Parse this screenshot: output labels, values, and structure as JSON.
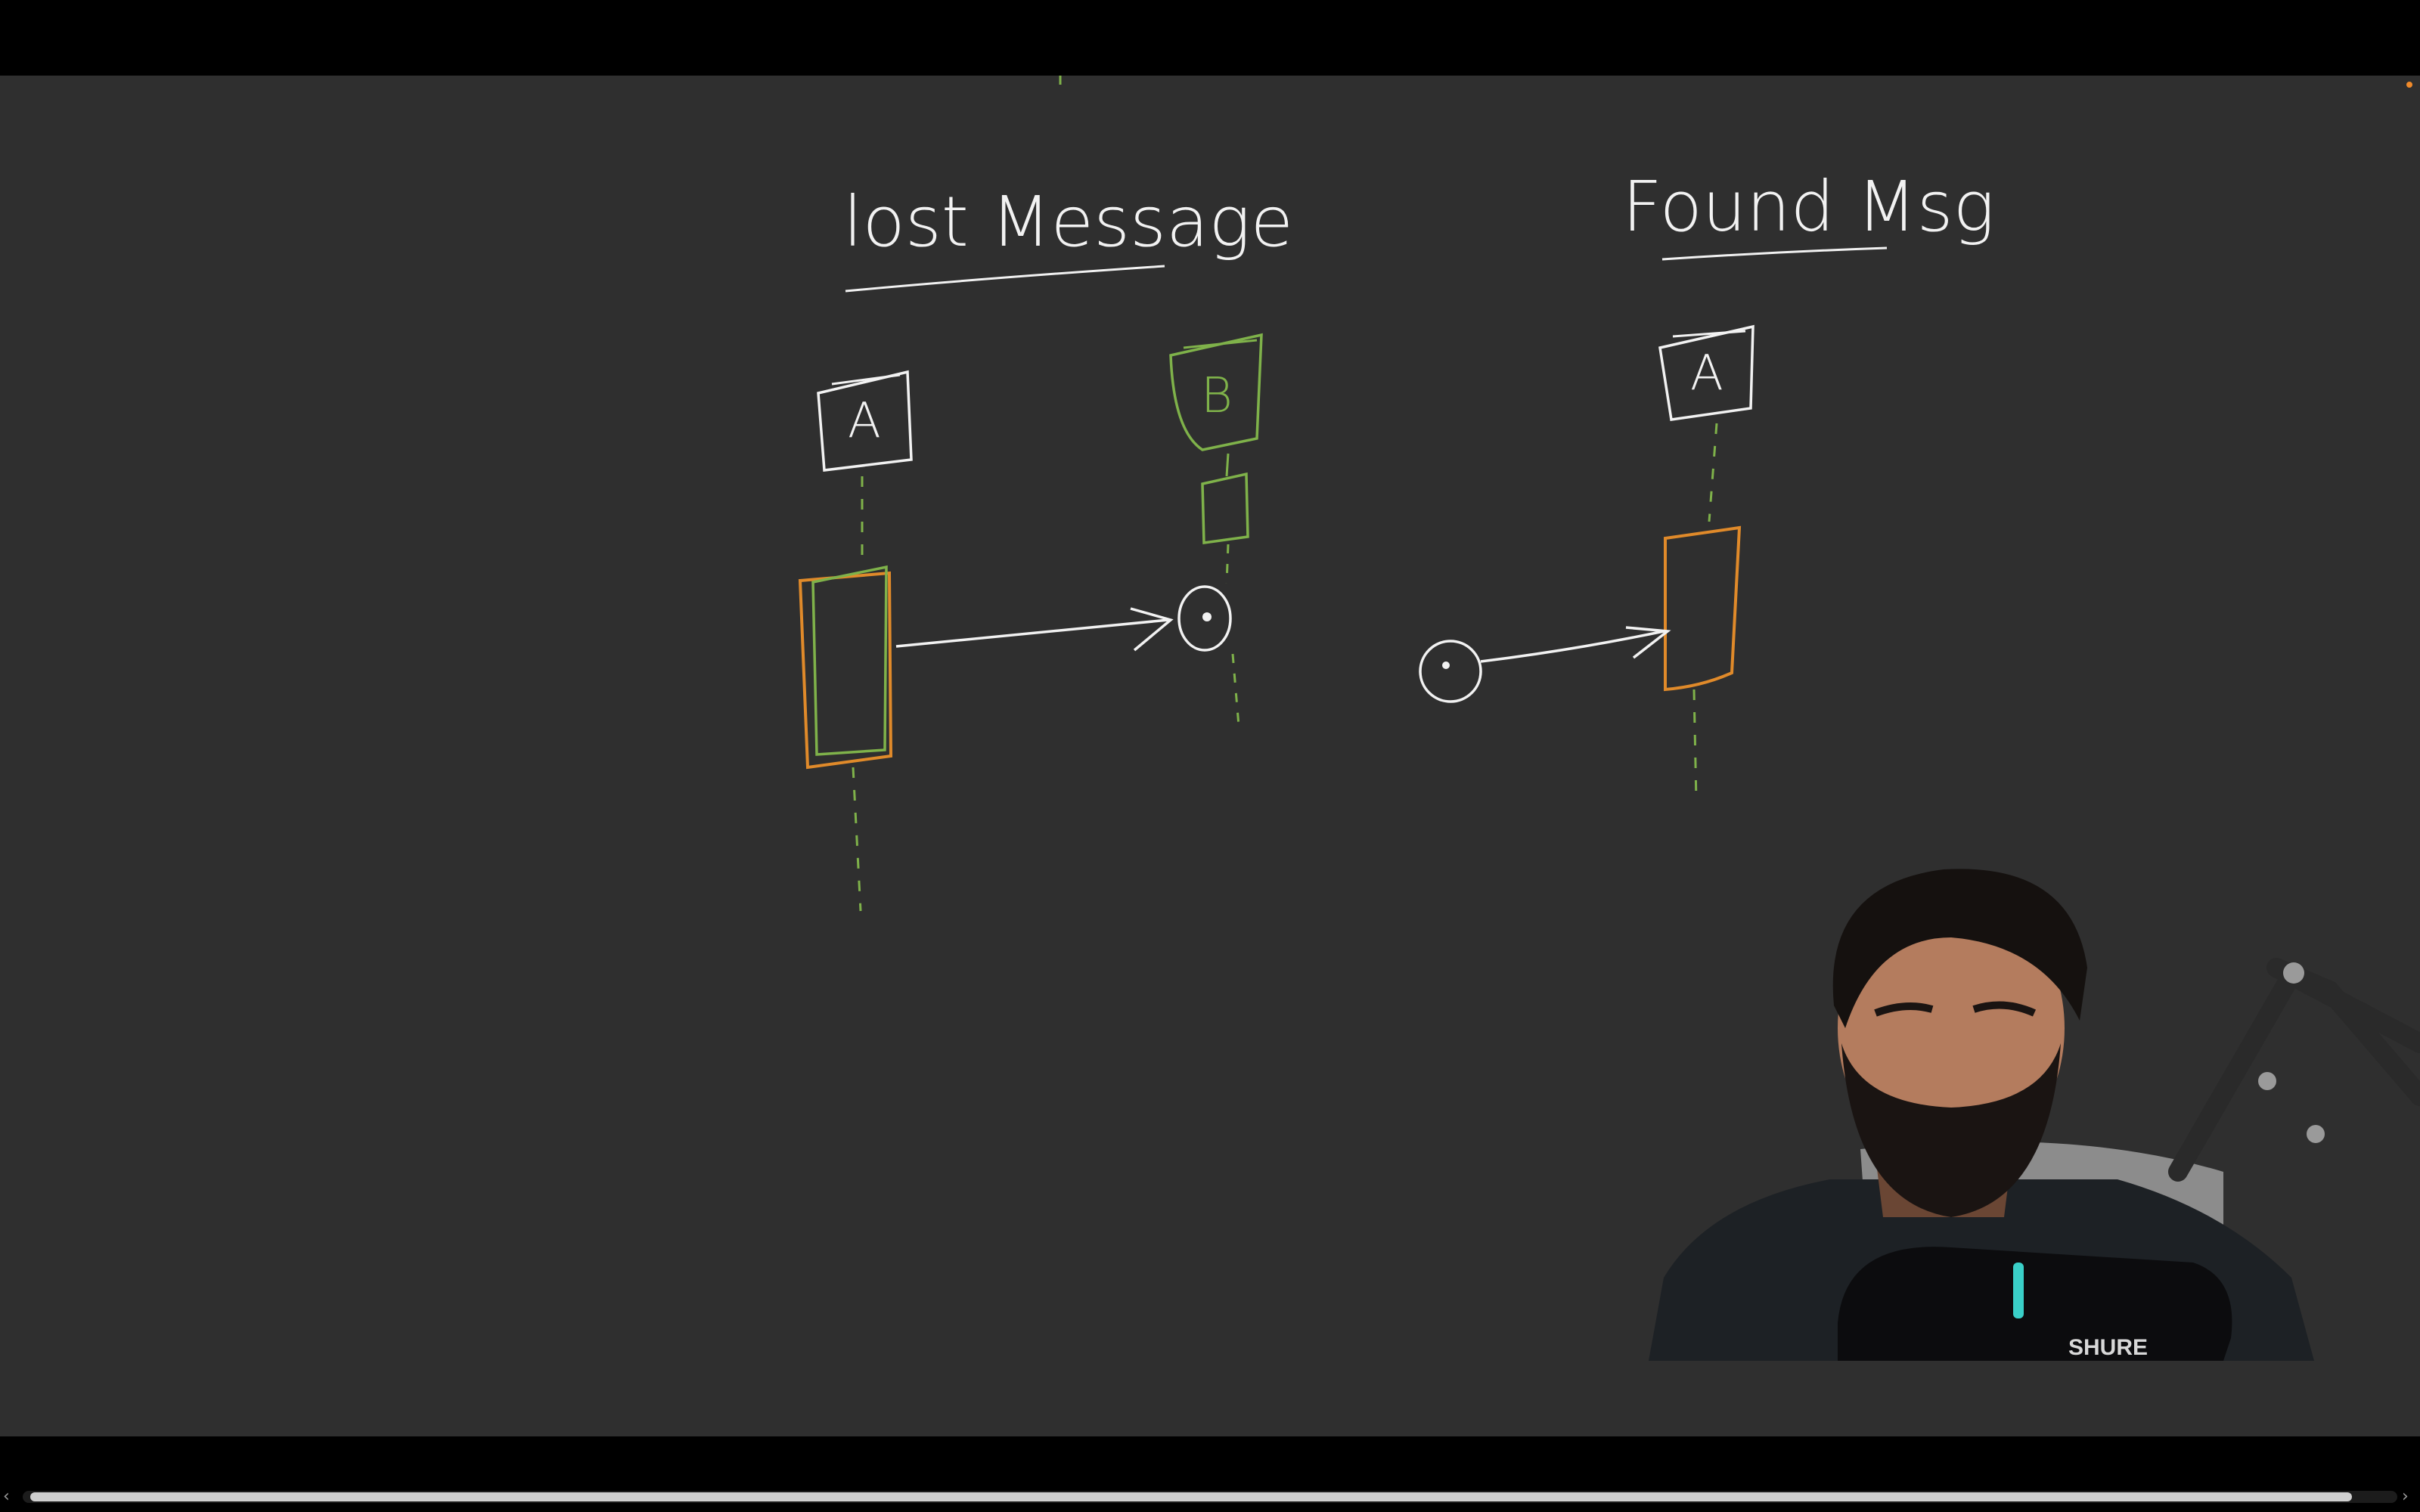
{
  "diagram": {
    "lost_title": "lost Message",
    "found_title": "Found Msg",
    "lost_actor_a": "A",
    "lost_actor_b": "B",
    "found_actor_a": "A"
  },
  "colors": {
    "background": "#2f2f2f",
    "ink": "#f2f2f2",
    "green": "#7fb24a",
    "orange": "#e08a2a"
  },
  "webcam": {
    "mic_brand": "SHURE"
  }
}
